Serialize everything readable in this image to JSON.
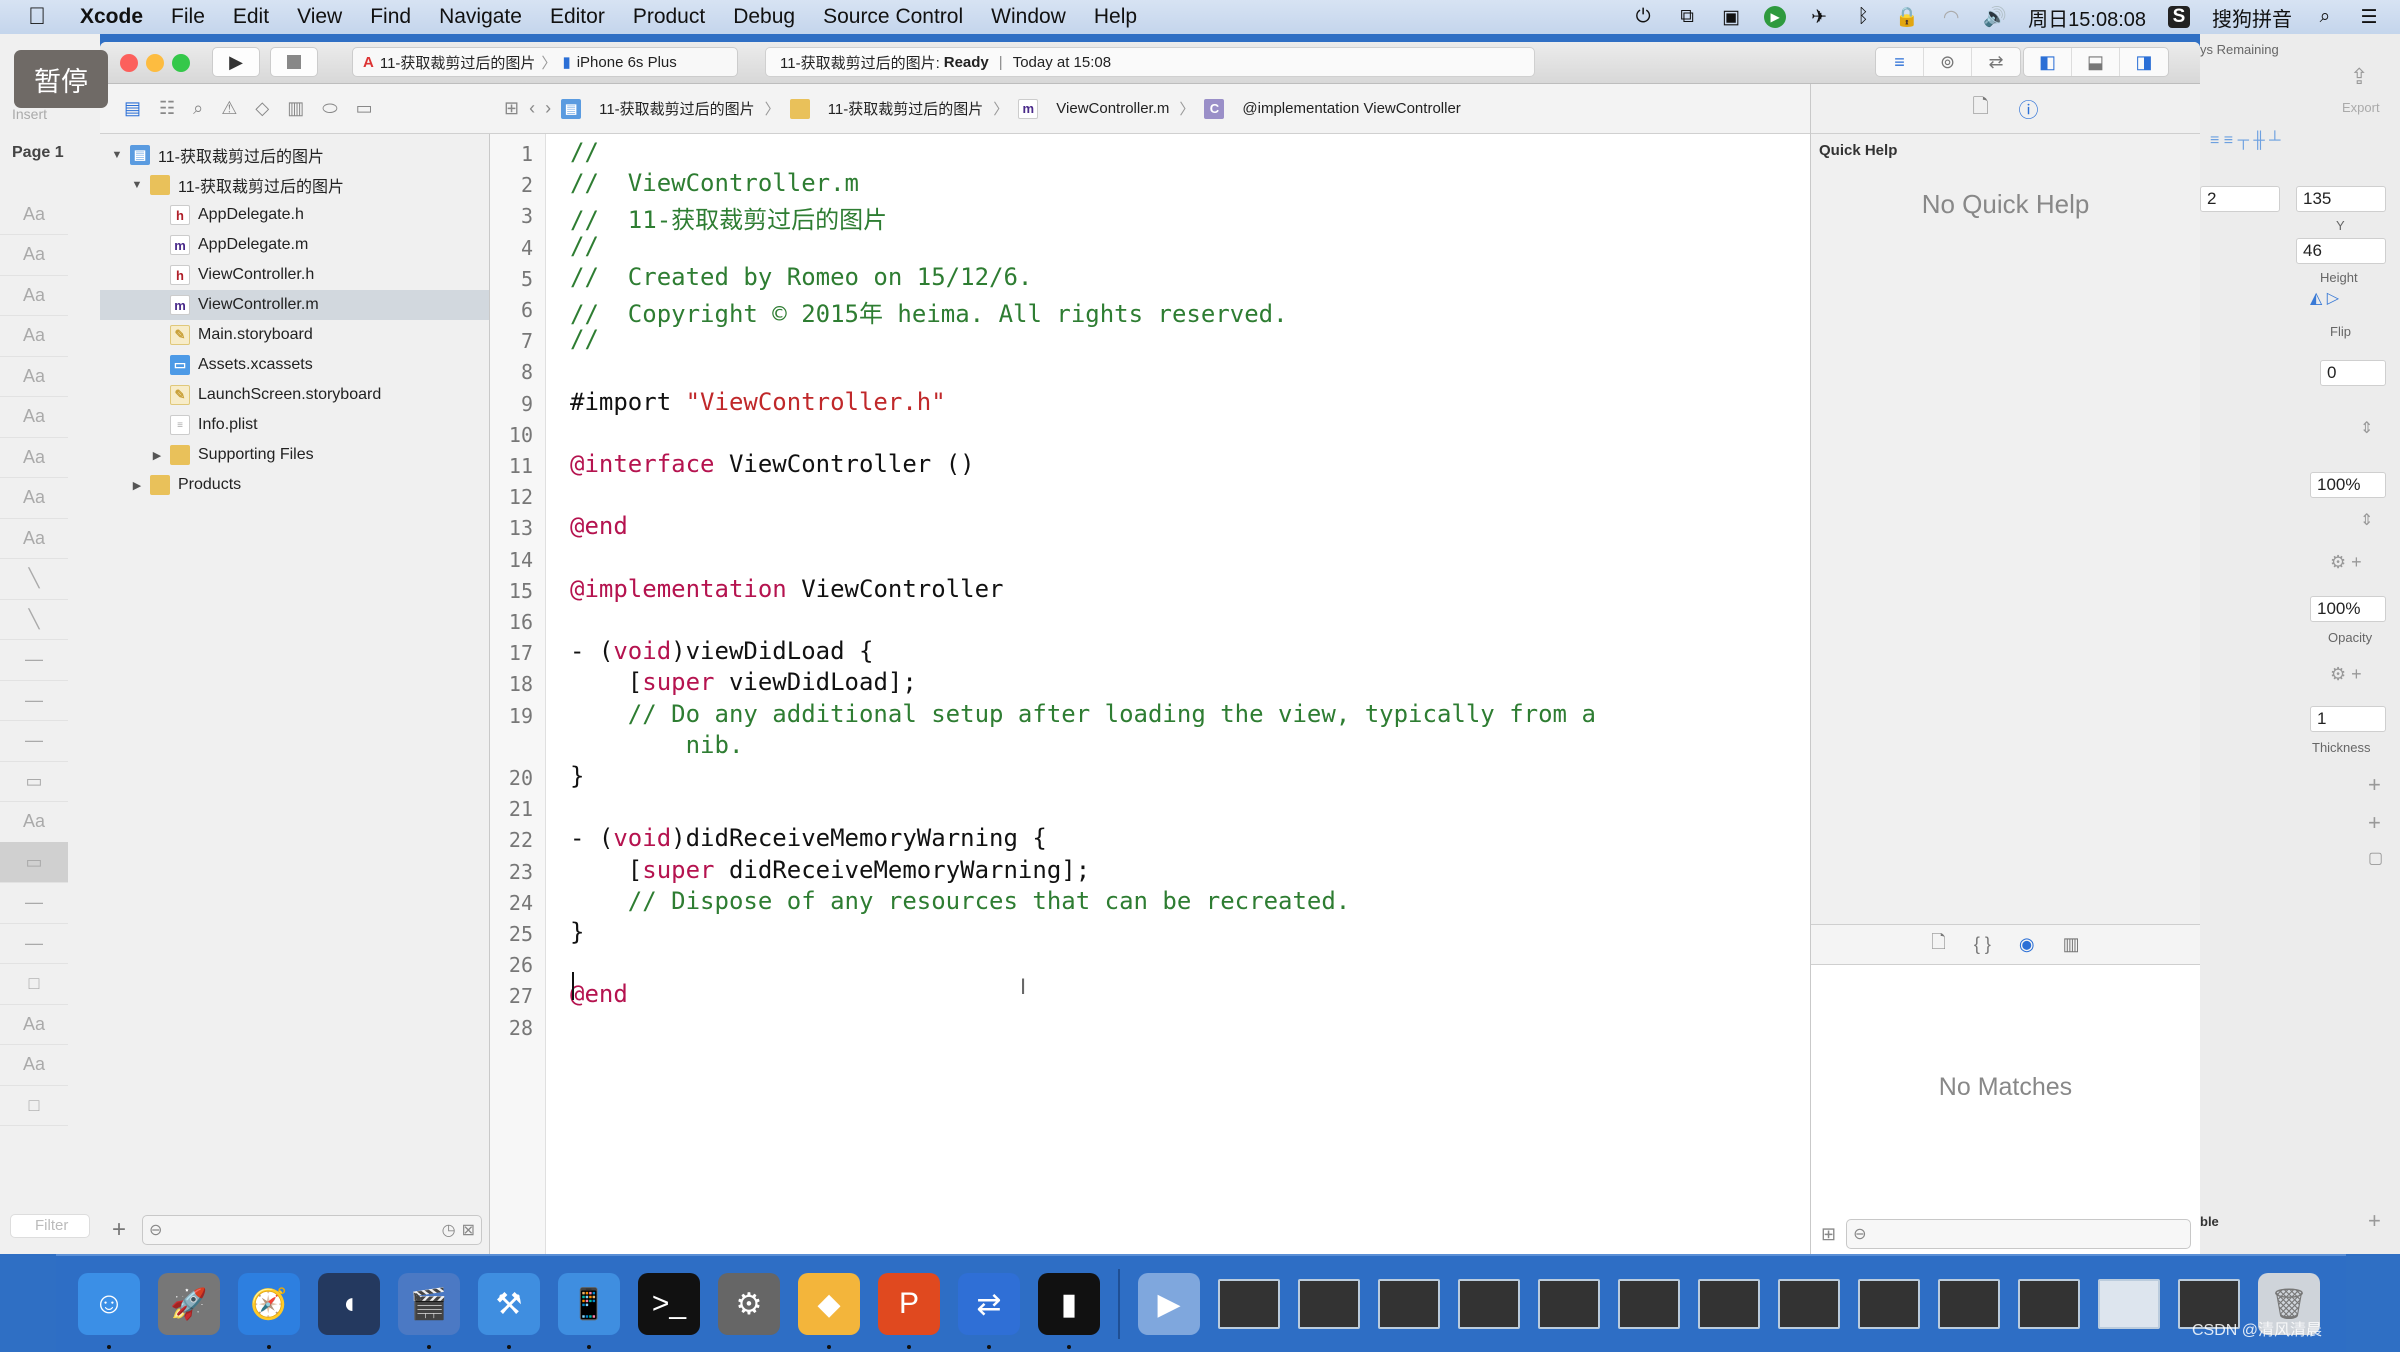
{
  "menubar": {
    "apple": "",
    "items": [
      "Xcode",
      "File",
      "Edit",
      "View",
      "Find",
      "Navigate",
      "Editor",
      "Product",
      "Debug",
      "Source Control",
      "Window",
      "Help"
    ],
    "clock": "周日15:08:08",
    "input_method": "搜狗拼音"
  },
  "overlay": {
    "pause_label": "暂停"
  },
  "toolbar": {
    "scheme_name": "11-获取裁剪过后的图片",
    "device": "iPhone 6s Plus",
    "status_project": "11-获取裁剪过后的图片:",
    "status_state": "Ready",
    "status_time": "Today at 15:08"
  },
  "navigator": {
    "items": [
      {
        "label": "11-获取裁剪过后的图片",
        "icon": "project",
        "level": 0,
        "expanded": true
      },
      {
        "label": "11-获取裁剪过后的图片",
        "icon": "folder",
        "level": 1,
        "expanded": true
      },
      {
        "label": "AppDelegate.h",
        "icon": "h",
        "level": 2
      },
      {
        "label": "AppDelegate.m",
        "icon": "m",
        "level": 2
      },
      {
        "label": "ViewController.h",
        "icon": "h",
        "level": 2
      },
      {
        "label": "ViewController.m",
        "icon": "m",
        "level": 2,
        "selected": true
      },
      {
        "label": "Main.storyboard",
        "icon": "storyboard",
        "level": 2
      },
      {
        "label": "Assets.xcassets",
        "icon": "assets",
        "level": 2
      },
      {
        "label": "LaunchScreen.storyboard",
        "icon": "storyboard",
        "level": 2
      },
      {
        "label": "Info.plist",
        "icon": "plist",
        "level": 2
      },
      {
        "label": "Supporting Files",
        "icon": "folder",
        "level": 2,
        "expanded": false
      },
      {
        "label": "Products",
        "icon": "folder",
        "level": 1,
        "expanded": false
      }
    ]
  },
  "jumpbar": {
    "crumbs": [
      "11-获取裁剪过后的图片",
      "11-获取裁剪过后的图片",
      "ViewController.m",
      "@implementation ViewController"
    ]
  },
  "editor": {
    "lines": [
      {
        "n": "1",
        "parts": [
          {
            "t": "//",
            "c": "cm"
          }
        ]
      },
      {
        "n": "2",
        "parts": [
          {
            "t": "//  ViewController.m",
            "c": "cm"
          }
        ]
      },
      {
        "n": "3",
        "parts": [
          {
            "t": "//  11-获取裁剪过后的图片",
            "c": "cm"
          }
        ]
      },
      {
        "n": "4",
        "parts": [
          {
            "t": "//",
            "c": "cm"
          }
        ]
      },
      {
        "n": "5",
        "parts": [
          {
            "t": "//  Created by Romeo on 15/12/6.",
            "c": "cm"
          }
        ]
      },
      {
        "n": "6",
        "parts": [
          {
            "t": "//  Copyright © 2015年 heima. All rights reserved.",
            "c": "cm"
          }
        ]
      },
      {
        "n": "7",
        "parts": [
          {
            "t": "//",
            "c": "cm"
          }
        ]
      },
      {
        "n": "8",
        "parts": []
      },
      {
        "n": "9",
        "parts": [
          {
            "t": "#import ",
            "c": "pp"
          },
          {
            "t": "\"ViewController.h\"",
            "c": "str"
          }
        ]
      },
      {
        "n": "10",
        "parts": []
      },
      {
        "n": "11",
        "parts": [
          {
            "t": "@interface",
            "c": "kw"
          },
          {
            "t": " ViewController ()",
            "c": ""
          }
        ]
      },
      {
        "n": "12",
        "parts": []
      },
      {
        "n": "13",
        "parts": [
          {
            "t": "@end",
            "c": "kw"
          }
        ]
      },
      {
        "n": "14",
        "parts": []
      },
      {
        "n": "15",
        "parts": [
          {
            "t": "@implementation",
            "c": "kw"
          },
          {
            "t": " ViewController",
            "c": ""
          }
        ]
      },
      {
        "n": "16",
        "parts": []
      },
      {
        "n": "17",
        "parts": [
          {
            "t": "- (",
            "c": ""
          },
          {
            "t": "void",
            "c": "kw"
          },
          {
            "t": ")viewDidLoad {",
            "c": ""
          }
        ]
      },
      {
        "n": "18",
        "parts": [
          {
            "t": "    [",
            "c": ""
          },
          {
            "t": "super",
            "c": "kw"
          },
          {
            "t": " viewDidLoad];",
            "c": ""
          }
        ]
      },
      {
        "n": "19",
        "parts": [
          {
            "t": "    // Do any additional setup after loading the view, typically from a",
            "c": "cm"
          }
        ]
      },
      {
        "n": "",
        "parts": [
          {
            "t": "        nib.",
            "c": "cm"
          }
        ]
      },
      {
        "n": "20",
        "parts": [
          {
            "t": "}",
            "c": ""
          }
        ]
      },
      {
        "n": "21",
        "parts": []
      },
      {
        "n": "22",
        "parts": [
          {
            "t": "- (",
            "c": ""
          },
          {
            "t": "void",
            "c": "kw"
          },
          {
            "t": ")didReceiveMemoryWarning {",
            "c": ""
          }
        ]
      },
      {
        "n": "23",
        "parts": [
          {
            "t": "    [",
            "c": ""
          },
          {
            "t": "super",
            "c": "kw"
          },
          {
            "t": " didReceiveMemoryWarning];",
            "c": ""
          }
        ]
      },
      {
        "n": "24",
        "parts": [
          {
            "t": "    // Dispose of any resources that can be recreated.",
            "c": "cm"
          }
        ]
      },
      {
        "n": "25",
        "parts": [
          {
            "t": "}",
            "c": ""
          }
        ]
      },
      {
        "n": "26",
        "parts": []
      },
      {
        "n": "27",
        "parts": [
          {
            "t": "@end",
            "c": "kw"
          }
        ]
      },
      {
        "n": "28",
        "parts": []
      }
    ]
  },
  "inspector": {
    "quick_help_title": "Quick Help",
    "quick_help_empty": "No Quick Help",
    "library_empty": "No Matches"
  },
  "background_app": {
    "trial": "ys Remaining",
    "export_label": "Export",
    "x_value": "2",
    "y_value": "135",
    "y_label": "Y",
    "height_value": "46",
    "height_label": "Height",
    "flip_label": "Flip",
    "rotate_value": "0",
    "fill_opacity": "100%",
    "opacity_value": "100%",
    "opacity_label": "Opacity",
    "thickness_value": "1",
    "thickness_label": "Thickness",
    "bottom_label": "ble",
    "left_insert": "Insert",
    "left_page": "Page 1",
    "left_filter": "Filter",
    "left_rows": [
      "Aa",
      "Aa",
      "Aa",
      "Aa",
      "Aa",
      "Aa",
      "Aa",
      "Aa",
      "Aa",
      "╲",
      "╲",
      "—",
      "—",
      "—",
      "▭",
      "Aa",
      "▭",
      "—",
      "—",
      "□",
      "Aa",
      "Aa",
      "□"
    ]
  },
  "dock": {
    "apps": [
      {
        "name": "finder",
        "glyph": "☺",
        "bg": "#3b8fe6",
        "running": true
      },
      {
        "name": "launchpad",
        "glyph": "🚀",
        "bg": "#777",
        "running": false
      },
      {
        "name": "safari",
        "glyph": "🧭",
        "bg": "#2d7fe0",
        "running": true
      },
      {
        "name": "mouse",
        "glyph": "◖",
        "bg": "#24395f",
        "running": false
      },
      {
        "name": "imovie",
        "glyph": "🎬",
        "bg": "#4b79c4",
        "running": true
      },
      {
        "name": "xcode",
        "glyph": "⚒",
        "bg": "#3f8ee0",
        "running": true
      },
      {
        "name": "simulator",
        "glyph": "📱",
        "bg": "#3f8ee0",
        "running": true
      },
      {
        "name": "terminal",
        "glyph": ">_",
        "bg": "#111",
        "running": false
      },
      {
        "name": "system-preferences",
        "glyph": "⚙",
        "bg": "#666",
        "running": false
      },
      {
        "name": "sketch",
        "glyph": "◆",
        "bg": "#f3b53b",
        "running": true
      },
      {
        "name": "paw",
        "glyph": "P",
        "bg": "#e0491f",
        "running": true
      },
      {
        "name": "teamviewer",
        "glyph": "⇄",
        "bg": "#2f6fd6",
        "running": true
      },
      {
        "name": "console",
        "glyph": "▮",
        "bg": "#111",
        "running": true
      }
    ],
    "minimized_count": 13,
    "watermark": "CSDN @清风清晨"
  }
}
